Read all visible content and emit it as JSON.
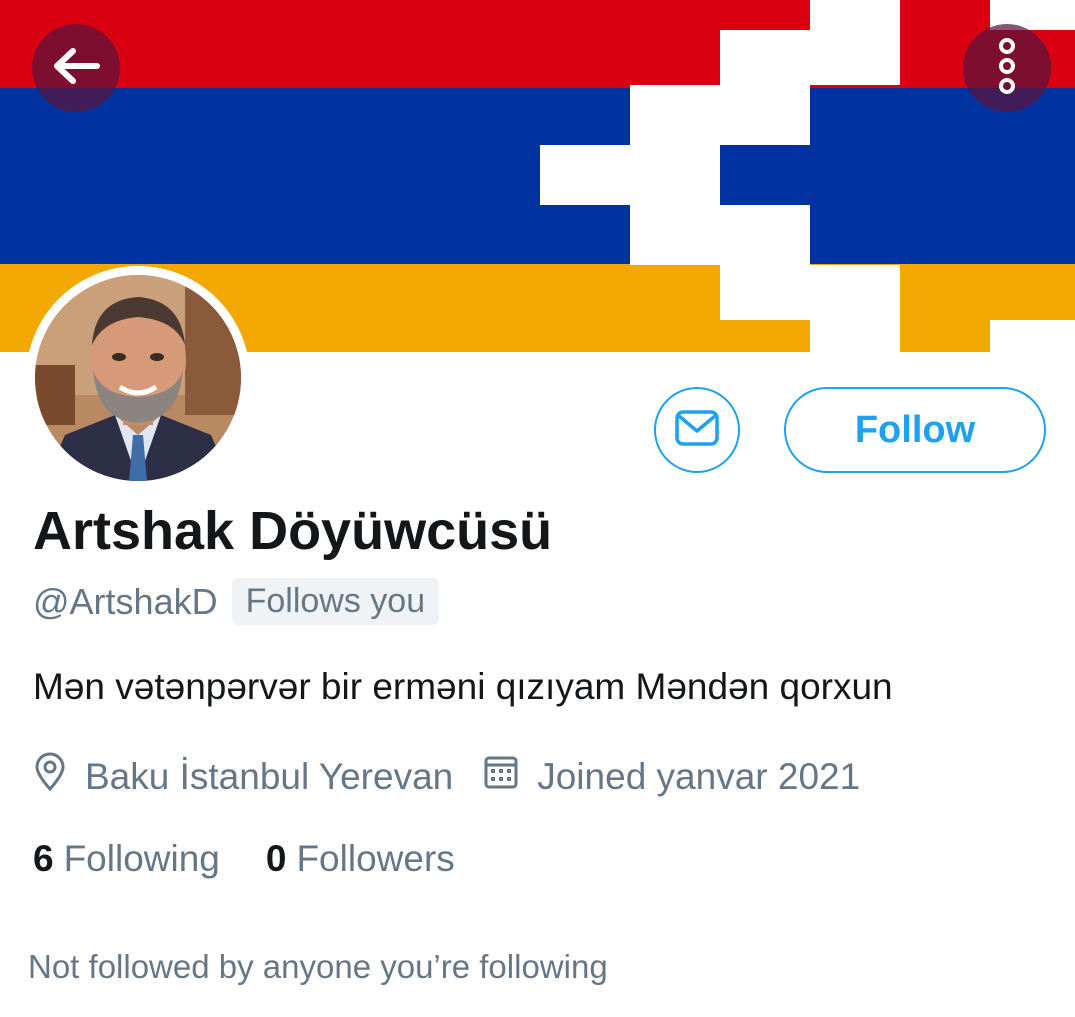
{
  "header": {
    "back_icon": "arrow-left-icon",
    "more_icon": "more-vertical-icon"
  },
  "banner": {
    "description_colors": [
      "#d90012",
      "#0033a0",
      "#f2a800",
      "#ffffff"
    ]
  },
  "profile": {
    "display_name": "Artshak Döyüwcüsü",
    "handle": "@ArtshakD",
    "follows_you_badge": "Follows you",
    "bio": "Mən vətənpərvər bir erməni qızıyam Məndən qorxun",
    "location": "Baku İstanbul Yerevan",
    "joined": "Joined yanvar 2021",
    "following_count": "6",
    "following_label": "Following",
    "followers_count": "0",
    "followers_label": "Followers",
    "not_followed_note": "Not followed by anyone you’re following"
  },
  "actions": {
    "message_icon": "envelope-icon",
    "follow_label": "Follow"
  },
  "colors": {
    "accent": "#1da1f2",
    "secondary_text": "#657786",
    "primary_text": "#14171a"
  }
}
